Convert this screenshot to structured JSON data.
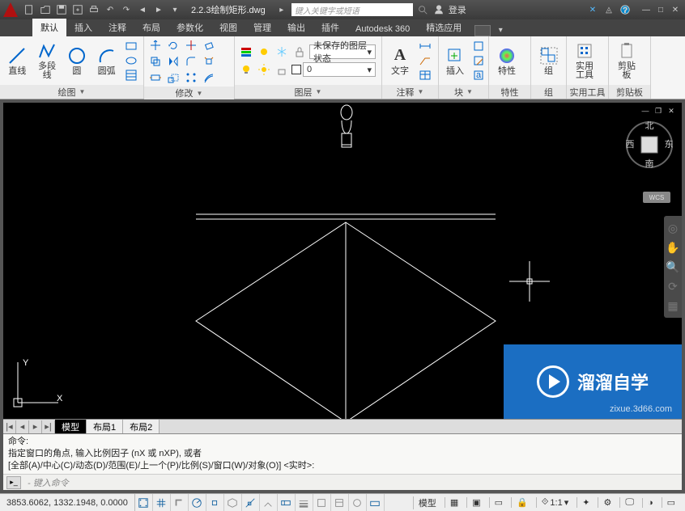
{
  "app": {
    "title": "2.2.3绘制矩形.dwg",
    "search_placeholder": "键入关键字或短语",
    "login_label": "登录"
  },
  "qat": [
    "new",
    "open",
    "save",
    "saveas",
    "print",
    "undo",
    "redo",
    "nav-prev",
    "nav-next"
  ],
  "ribbon_tabs": [
    "默认",
    "插入",
    "注释",
    "布局",
    "参数化",
    "视图",
    "管理",
    "输出",
    "插件",
    "Autodesk 360",
    "精选应用"
  ],
  "ribbon_active": 0,
  "panels": {
    "draw": {
      "title": "绘图",
      "items": [
        "直线",
        "多段线",
        "圆",
        "圆弧"
      ]
    },
    "modify": {
      "title": "修改"
    },
    "layers": {
      "title": "图层",
      "state": "未保存的图层状态",
      "current": "0"
    },
    "annot": {
      "title": "注释",
      "text": "文字"
    },
    "block": {
      "title": "块",
      "insert": "插入"
    },
    "props": {
      "title": "特性"
    },
    "group": {
      "title": "组"
    },
    "utils": {
      "title": "实用工具"
    },
    "clip": {
      "title": "剪贴板"
    }
  },
  "viewcube": {
    "n": "北",
    "s": "南",
    "e": "东",
    "w": "西",
    "wcs": "WCS"
  },
  "model_tabs": [
    "模型",
    "布局1",
    "布局2"
  ],
  "model_active": 0,
  "command": {
    "label": "命令:",
    "hist1": "指定窗口的角点, 输入比例因子 (nX 或 nXP), 或者",
    "hist2": "[全部(A)/中心(C)/动态(D)/范围(E)/上一个(P)/比例(S)/窗口(W)/对象(O)] <实时>:",
    "placeholder": "- 键入命令"
  },
  "status": {
    "coords": "3853.6062, 1332.1948, 0.0000",
    "model": "模型",
    "scale": "1:1"
  },
  "watermark": {
    "brand": "溜溜自学",
    "url": "zixue.3d66.com"
  },
  "chart_data": null
}
